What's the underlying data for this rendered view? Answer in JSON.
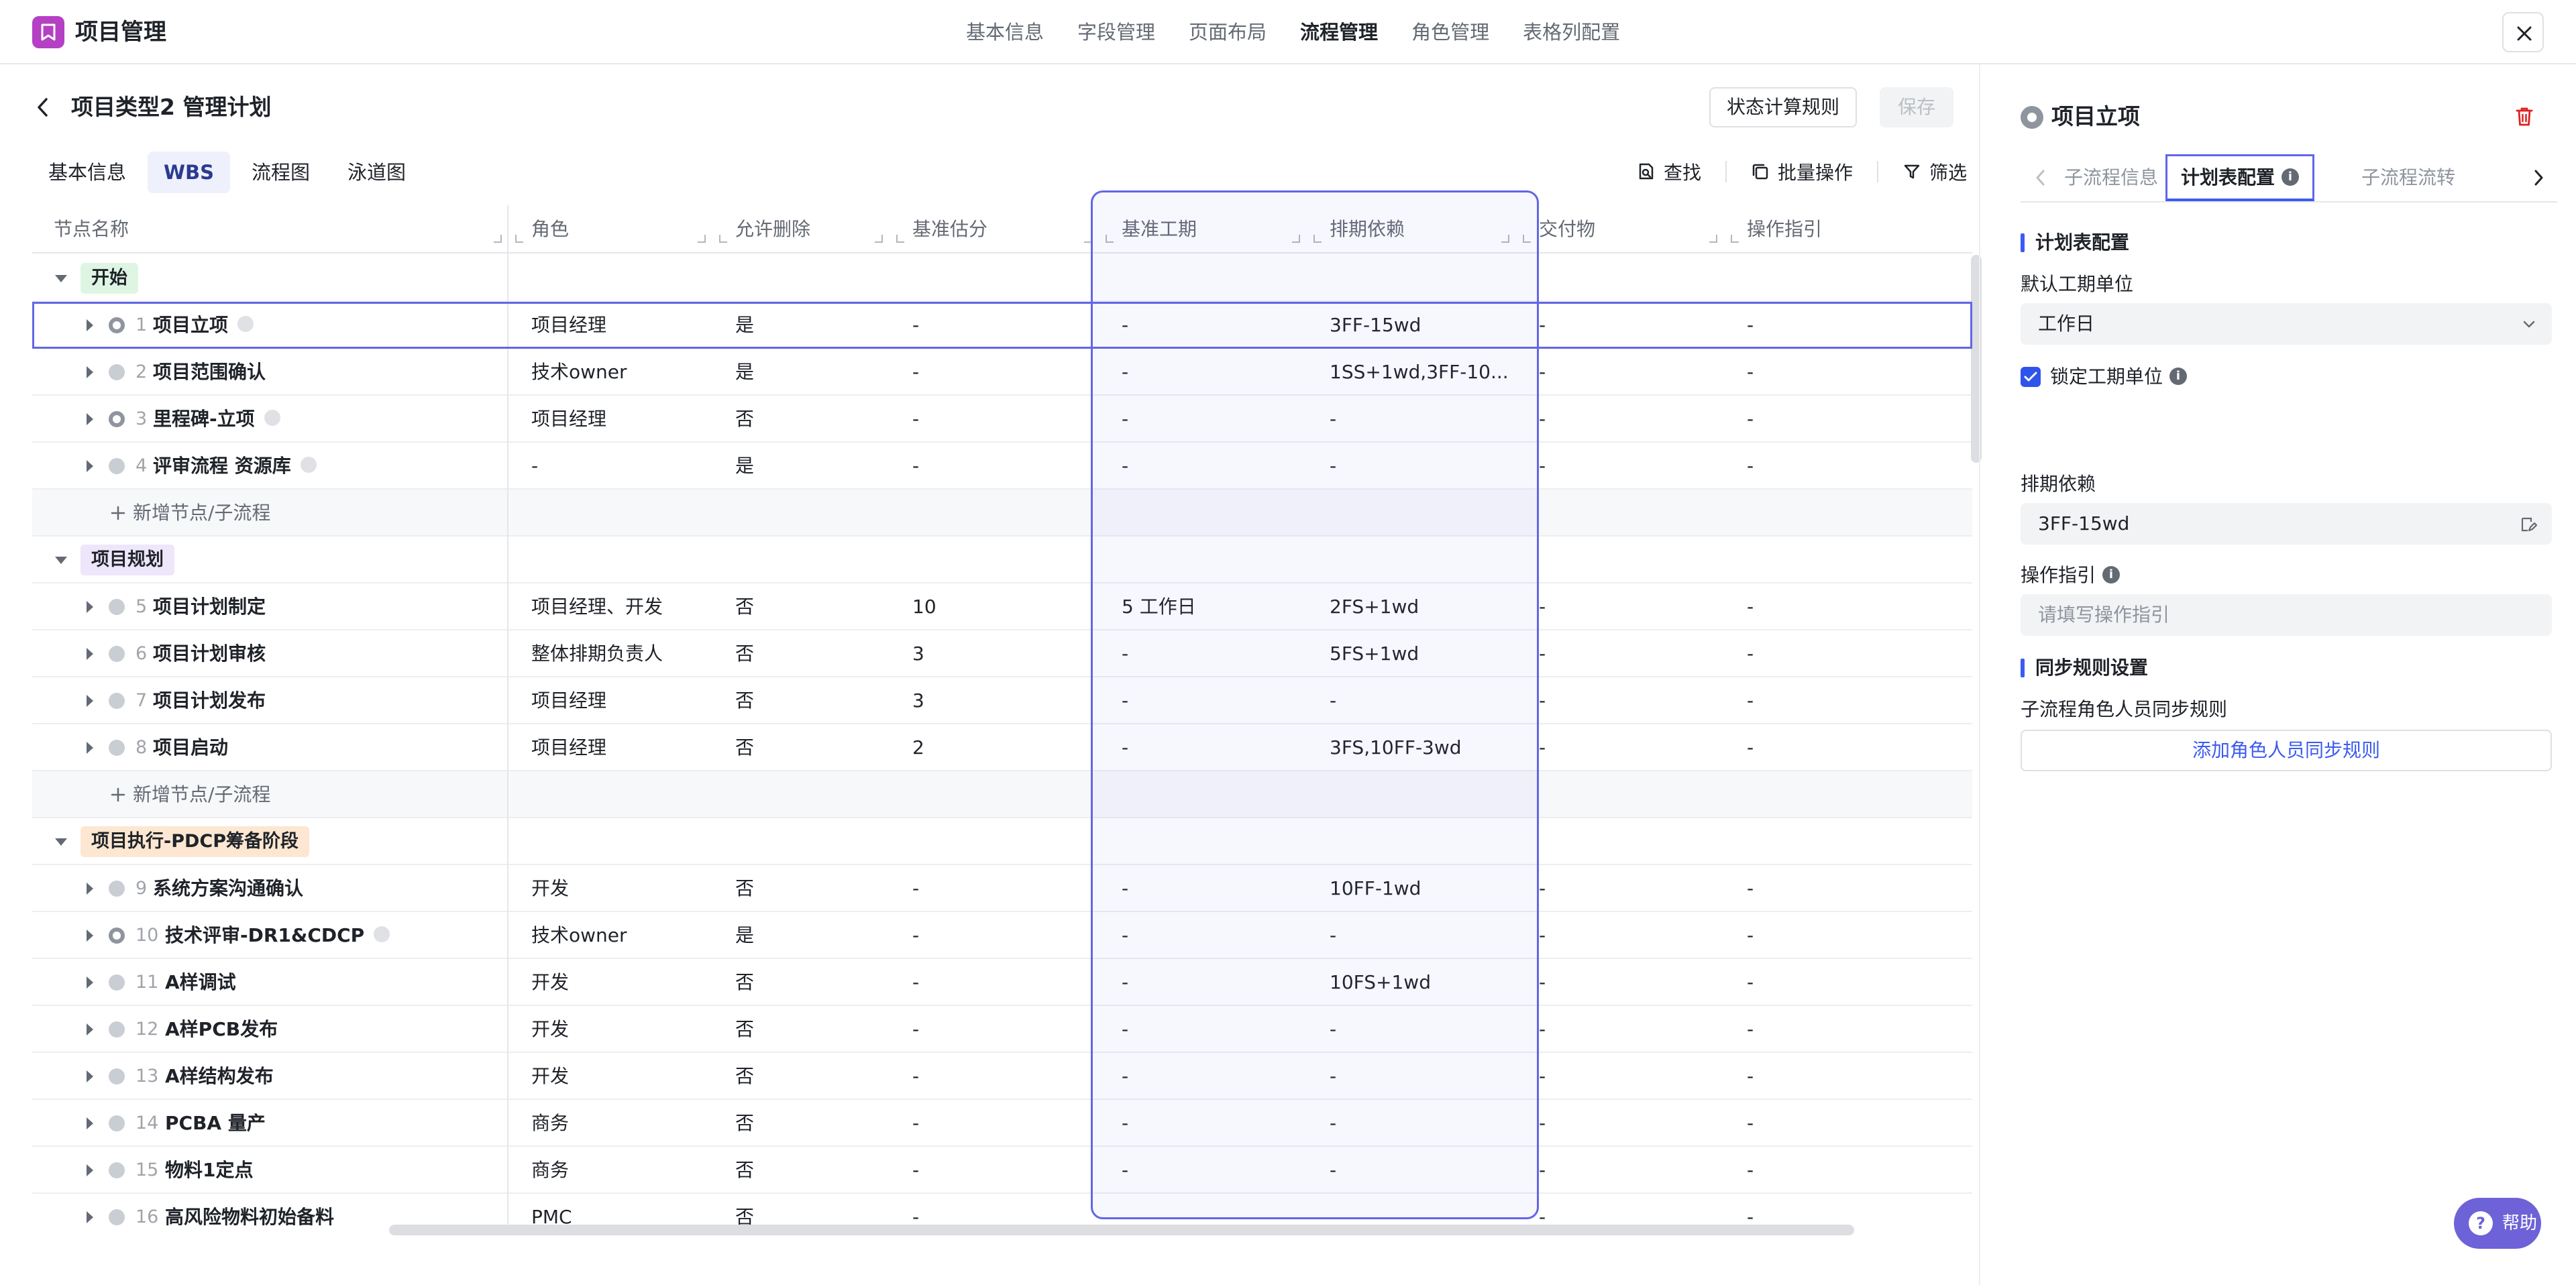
{
  "app": {
    "title": "项目管理"
  },
  "top_nav": [
    "基本信息",
    "字段管理",
    "页面布局",
    "流程管理",
    "角色管理",
    "表格列配置"
  ],
  "top_nav_active": 3,
  "page": {
    "title": "项目类型2 管理计划",
    "btn_rules": "状态计算规则",
    "btn_save": "保存",
    "subtabs": [
      "基本信息",
      "WBS",
      "流程图",
      "泳道图"
    ],
    "subtab_active": 1,
    "tools": {
      "find": "查找",
      "batch": "批量操作",
      "filter": "筛选"
    }
  },
  "columns": [
    "节点名称",
    "角色",
    "允许删除",
    "基准估分",
    "基准工期",
    "排期依赖",
    "交付物",
    "操作指引"
  ],
  "rows": [
    {
      "type": "group",
      "label": "开始",
      "tone": "green"
    },
    {
      "type": "node",
      "idx": "1",
      "name": "项目立项",
      "flag": true,
      "tag": true,
      "role": "项目经理",
      "del": "是",
      "est": "-",
      "dur": "-",
      "dep": "3FF-15wd",
      "deliv": "-",
      "guide": "-",
      "selected": true
    },
    {
      "type": "node",
      "idx": "2",
      "name": "项目范围确认",
      "flag": false,
      "tag": false,
      "role": "技术owner",
      "del": "是",
      "est": "-",
      "dur": "-",
      "dep": "1SS+1wd,3FF-10...",
      "deliv": "-",
      "guide": "-"
    },
    {
      "type": "node",
      "idx": "3",
      "name": "里程碑-立项",
      "flag": true,
      "tag": true,
      "role": "项目经理",
      "del": "否",
      "est": "-",
      "dur": "-",
      "dep": "-",
      "deliv": "-",
      "guide": "-"
    },
    {
      "type": "node",
      "idx": "4",
      "name": "评审流程 资源库",
      "flag": false,
      "tag": true,
      "role": "-",
      "del": "是",
      "est": "-",
      "dur": "-",
      "dep": "-",
      "deliv": "-",
      "guide": "-"
    },
    {
      "type": "add",
      "label": "新增节点/子流程"
    },
    {
      "type": "group",
      "label": "项目规划",
      "tone": "purple"
    },
    {
      "type": "node",
      "idx": "5",
      "name": "项目计划制定",
      "flag": false,
      "tag": false,
      "role": "项目经理、开发",
      "del": "否",
      "est": "10",
      "dur": "5 工作日",
      "dep": "2FS+1wd",
      "deliv": "-",
      "guide": "-"
    },
    {
      "type": "node",
      "idx": "6",
      "name": "项目计划审核",
      "flag": false,
      "tag": false,
      "role": "整体排期负责人",
      "del": "否",
      "est": "3",
      "dur": "-",
      "dep": "5FS+1wd",
      "deliv": "-",
      "guide": "-"
    },
    {
      "type": "node",
      "idx": "7",
      "name": "项目计划发布",
      "flag": false,
      "tag": false,
      "role": "项目经理",
      "del": "否",
      "est": "3",
      "dur": "-",
      "dep": "-",
      "deliv": "-",
      "guide": "-"
    },
    {
      "type": "node",
      "idx": "8",
      "name": "项目启动",
      "flag": false,
      "tag": false,
      "role": "项目经理",
      "del": "否",
      "est": "2",
      "dur": "-",
      "dep": "3FS,10FF-3wd",
      "deliv": "-",
      "guide": "-"
    },
    {
      "type": "add",
      "label": "新增节点/子流程"
    },
    {
      "type": "group",
      "label": "项目执行-PDCP筹备阶段",
      "tone": "orange"
    },
    {
      "type": "node",
      "idx": "9",
      "name": "系统方案沟通确认",
      "flag": false,
      "tag": false,
      "role": "开发",
      "del": "否",
      "est": "-",
      "dur": "-",
      "dep": "10FF-1wd",
      "deliv": "-",
      "guide": "-"
    },
    {
      "type": "node",
      "idx": "10",
      "name": "技术评审-DR1&CDCP",
      "flag": true,
      "tag": true,
      "role": "技术owner",
      "del": "是",
      "est": "-",
      "dur": "-",
      "dep": "-",
      "deliv": "-",
      "guide": "-"
    },
    {
      "type": "node",
      "idx": "11",
      "name": "A样调试",
      "flag": false,
      "tag": false,
      "role": "开发",
      "del": "否",
      "est": "-",
      "dur": "-",
      "dep": "10FS+1wd",
      "deliv": "-",
      "guide": "-"
    },
    {
      "type": "node",
      "idx": "12",
      "name": "A样PCB发布",
      "flag": false,
      "tag": false,
      "role": "开发",
      "del": "否",
      "est": "-",
      "dur": "-",
      "dep": "-",
      "deliv": "-",
      "guide": "-"
    },
    {
      "type": "node",
      "idx": "13",
      "name": "A样结构发布",
      "flag": false,
      "tag": false,
      "role": "开发",
      "del": "否",
      "est": "-",
      "dur": "-",
      "dep": "-",
      "deliv": "-",
      "guide": "-"
    },
    {
      "type": "node",
      "idx": "14",
      "name": "PCBA 量产",
      "flag": false,
      "tag": false,
      "role": "商务",
      "del": "否",
      "est": "-",
      "dur": "-",
      "dep": "-",
      "deliv": "-",
      "guide": "-"
    },
    {
      "type": "node",
      "idx": "15",
      "name": "物料1定点",
      "flag": false,
      "tag": false,
      "role": "商务",
      "del": "否",
      "est": "-",
      "dur": "-",
      "dep": "-",
      "deliv": "-",
      "guide": "-"
    },
    {
      "type": "node",
      "idx": "16",
      "name": "高风险物料初始备料",
      "flag": false,
      "tag": false,
      "role": "PMC",
      "del": "否",
      "est": "-",
      "dur": "-",
      "dep": "-",
      "deliv": "-",
      "guide": "-"
    }
  ],
  "panel": {
    "title": "项目立项",
    "tabs": [
      "子流程信息",
      "计划表配置",
      "子流程流转"
    ],
    "tab_active": 1,
    "section_plan": "计划表配置",
    "default_unit_label": "默认工期单位",
    "default_unit_value": "工作日",
    "lock_unit_label": "锁定工期单位",
    "lock_unit_checked": true,
    "dep_label": "排期依赖",
    "dep_value": "3FF-15wd",
    "guide_label": "操作指引",
    "guide_placeholder": "请填写操作指引",
    "section_sync": "同步规则设置",
    "sync_label": "子流程角色人员同步规则",
    "sync_button": "添加角色人员同步规则"
  },
  "help": {
    "label": "帮助"
  },
  "colors": {
    "accent": "#3c5bf0",
    "highlight": "#6366e6",
    "brand": "#b540c4",
    "help": "#6e62d8",
    "group_green": "#dff5e3",
    "group_purple": "#eee6fb",
    "group_orange": "#fde7d2"
  }
}
